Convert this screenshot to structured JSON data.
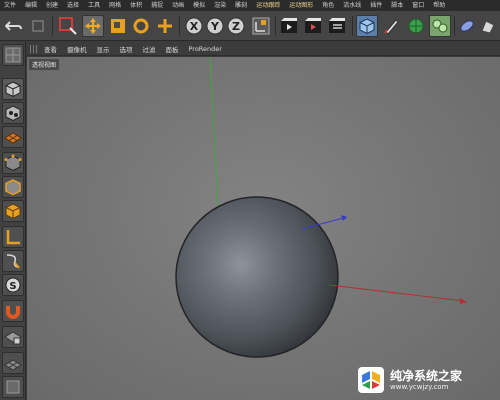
{
  "menubar": {
    "items": [
      "文件",
      "编辑",
      "创建",
      "选择",
      "工具",
      "网格",
      "体积",
      "捕捉",
      "动画",
      "模拟",
      "渲染",
      "雕刻",
      "运动跟踪",
      "运动图形",
      "角色",
      "流水线",
      "插件",
      "脚本",
      "窗口",
      "帮助"
    ]
  },
  "viewport_menu": {
    "items": [
      "查看",
      "摄像机",
      "显示",
      "选项",
      "过滤",
      "面板",
      "ProRender"
    ]
  },
  "viewport": {
    "label": "透视视图"
  },
  "watermark": {
    "brand": "纯净系统之家",
    "url": "www.ycwjzy.com"
  },
  "colors": {
    "menubar_bg": "#2b2b2b",
    "toolbar_bg": "#454545",
    "viewport_bg": "#7a7a7a",
    "sphere": "#5a5f66",
    "axis_y": "#3ea83e",
    "axis_x": "#b03030",
    "axis_z": "#3a3ac8",
    "highlight_menu": "#e8d28a"
  },
  "icons": {
    "toolbar": [
      "undo-icon",
      "redo-icon",
      "live-selection-icon",
      "move-icon",
      "scale-icon",
      "rotate-icon",
      "recent-tool-icon",
      "x-axis-icon",
      "y-axis-icon",
      "z-axis-icon",
      "coordinate-system-icon",
      "render-view-icon",
      "render-picture-viewer-icon",
      "render-settings-icon",
      "cube-icon",
      "pen-icon",
      "subdivision-icon",
      "array-icon",
      "deformer-icon",
      "scene-icon",
      "camera-icon",
      "light-icon"
    ],
    "palette": [
      "make-editable-icon",
      "model-mode-icon",
      "texture-mode-icon",
      "workplane-icon",
      "points-mode-icon",
      "edges-mode-icon",
      "polygons-mode-icon",
      "axis-mode-icon",
      "tweak-icon",
      "snap-icon",
      "magnet-icon",
      "lock-workplane-icon",
      "grid-icon"
    ]
  }
}
